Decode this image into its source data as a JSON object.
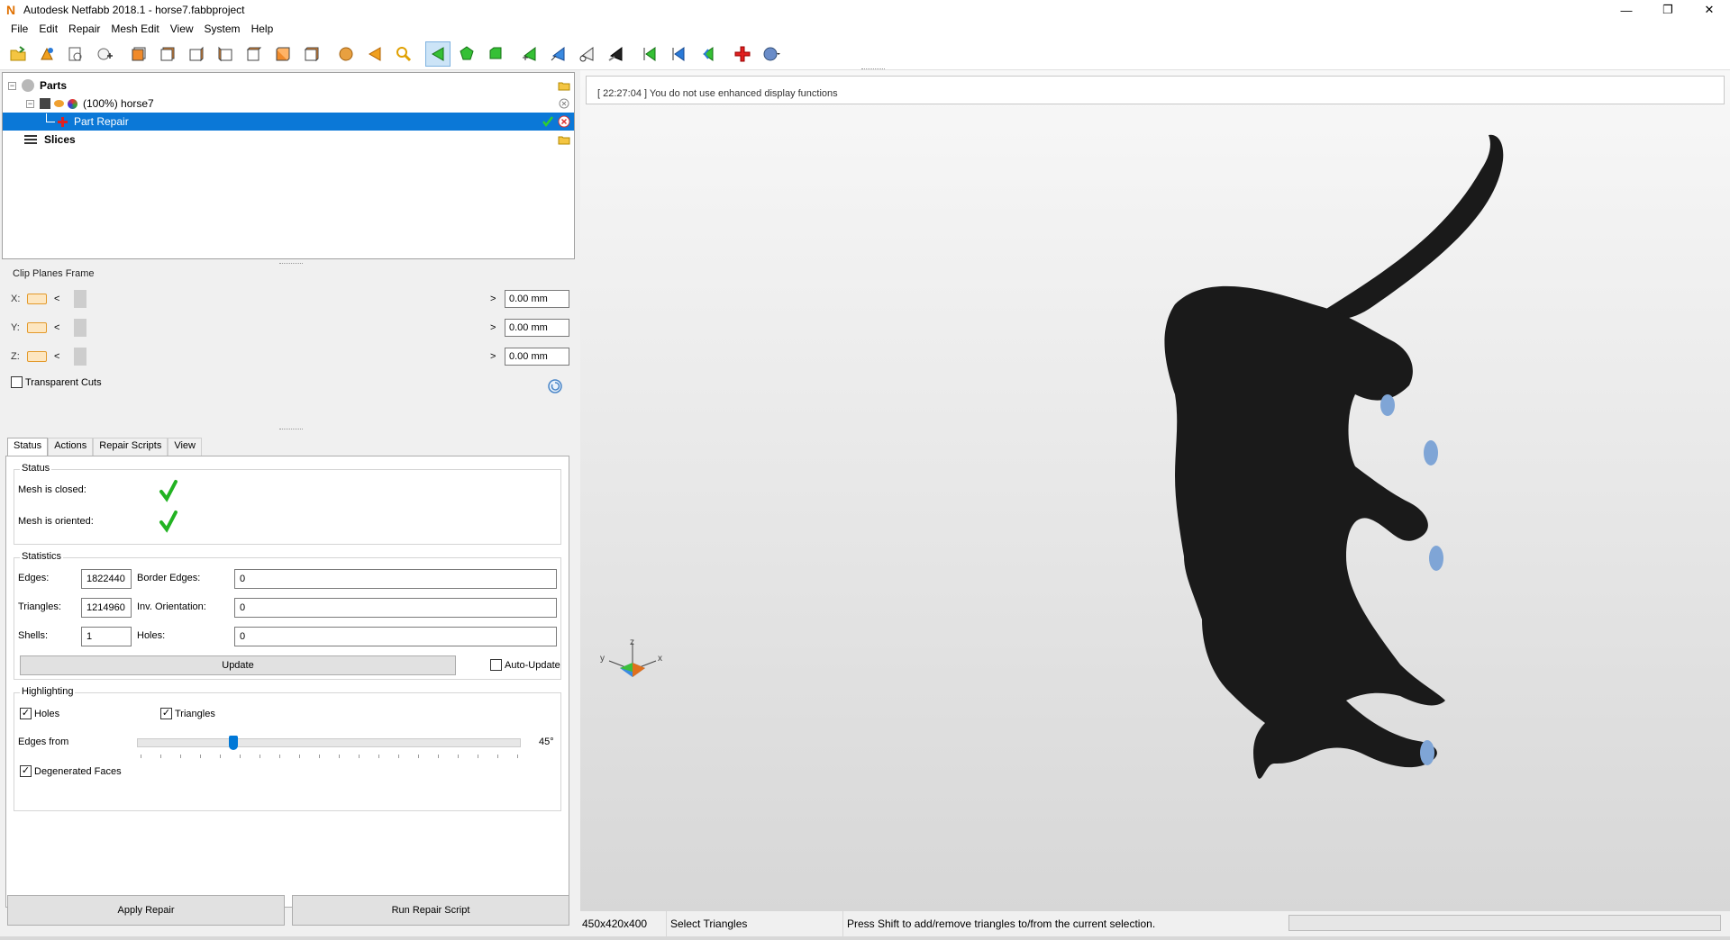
{
  "window": {
    "title": "Autodesk Netfabb 2018.1 - horse7.fabbproject",
    "minimize": "—",
    "restore": "❐",
    "close": "✕"
  },
  "menu": [
    "File",
    "Edit",
    "Repair",
    "Mesh Edit",
    "View",
    "System",
    "Help"
  ],
  "toolbar": {
    "icons": [
      "open-project-icon",
      "add-part-icon",
      "export-icon",
      "add-icon",
      "front-view-icon",
      "back-view-icon",
      "left-view-icon",
      "right-view-icon",
      "top-view-icon",
      "bottom-view-icon",
      "perspective-view-icon",
      "sphere-icon",
      "back-arrow-icon",
      "zoom-icon",
      "select-triangle-icon",
      "select-surface-icon",
      "select-shell-icon",
      "add-triangle-icon",
      "move-point-icon",
      "cut-icon",
      "erase-icon",
      "view-left-icon",
      "view-center-icon",
      "view-right-icon",
      "repair-icon",
      "help-icon"
    ]
  },
  "tree": {
    "parts_label": "Parts",
    "part_label": "(100%) horse7",
    "repair_label": "Part Repair",
    "slices_label": "Slices"
  },
  "clip": {
    "title": "Clip Planes Frame",
    "rows": [
      {
        "axis": "X:",
        "value": "0.00 mm"
      },
      {
        "axis": "Y:",
        "value": "0.00 mm"
      },
      {
        "axis": "Z:",
        "value": "0.00 mm"
      }
    ],
    "transparent_label": "Transparent Cuts",
    "transparent_checked": false
  },
  "tabs": [
    "Status",
    "Actions",
    "Repair Scripts",
    "View"
  ],
  "status": {
    "group_title": "Status",
    "closed_label": "Mesh is closed:",
    "oriented_label": "Mesh is oriented:"
  },
  "statistics": {
    "group_title": "Statistics",
    "edges_label": "Edges:",
    "edges": "1822440",
    "border_edges_label": "Border Edges:",
    "border_edges": "0",
    "triangles_label": "Triangles:",
    "triangles": "1214960",
    "inv_orientation_label": "Inv. Orientation:",
    "inv_orientation": "0",
    "shells_label": "Shells:",
    "shells": "1",
    "holes_label": "Holes:",
    "holes": "0",
    "update_button": "Update",
    "auto_update_label": "Auto-Update"
  },
  "highlighting": {
    "group_title": "Highlighting",
    "holes_label": "Holes",
    "triangles_label": "Triangles",
    "edges_from_label": "Edges from",
    "edges_from_value": "45°",
    "edges_from_fraction": 0.25,
    "degenerated_label": "Degenerated Faces"
  },
  "actions": {
    "apply_repair": "Apply Repair",
    "run_repair_script": "Run Repair Script"
  },
  "log": {
    "message": "[ 22:27:04 ] You do not use enhanced display functions"
  },
  "axes": {
    "z": "z",
    "y": "y",
    "x": "x"
  },
  "statusbar": {
    "dimensions": "450x420x400",
    "mode": "Select Triangles",
    "hint": "Press Shift to add/remove triangles to/from the current selection."
  },
  "colors": {
    "selection": "#0b78d7",
    "mesh": "#1a1a1a",
    "hoof": "#7fa5d6"
  }
}
